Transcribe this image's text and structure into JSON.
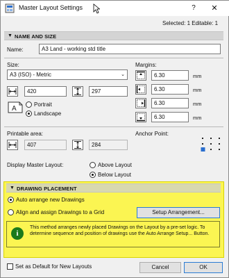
{
  "window": {
    "title": "Master Layout Settings",
    "help_glyph": "?",
    "close_glyph": "✕"
  },
  "selected_info": "Selected: 1 Editable: 1",
  "name_size": {
    "header": "NAME AND SIZE",
    "name_label": "Name:",
    "name_value": "A3 Land - working std title",
    "size_label": "Size:",
    "size_value": "A3 (ISO) - Metric",
    "width_value": "420",
    "height_value": "297",
    "portrait_label": "Portrait",
    "landscape_label": "Landscape",
    "orientation_selected": "Landscape",
    "margins_label": "Margins:",
    "margins": [
      {
        "value": "6.30",
        "unit": "mm"
      },
      {
        "value": "6.30",
        "unit": "mm"
      },
      {
        "value": "6.30",
        "unit": "mm"
      },
      {
        "value": "6.30",
        "unit": "mm"
      }
    ],
    "printable_label": "Printable area:",
    "printable_width": "407",
    "printable_height": "284",
    "anchor_label": "Anchor Point:",
    "display_label": "Display Master Layout:",
    "above_label": "Above Layout",
    "below_label": "Below Layout",
    "display_selected": "Below Layout"
  },
  "drawing_placement": {
    "header": "DRAWING PLACEMENT",
    "auto_label": "Auto arrange new Drawings",
    "align_label": "Align and assign Drawings to a Grid",
    "selected": "Auto arrange new Drawings",
    "setup_button": "Setup Arrangement...",
    "info_text": "This method arranges newly placed Drawings on the Layout by a pre-set logic. To determine sequence and position of drawings use the Auto Arrange Setup... Button."
  },
  "footer": {
    "default_checkbox_label": "Set as Default for New Layouts",
    "cancel_label": "Cancel",
    "ok_label": "OK"
  },
  "colors": {
    "highlight": "#fbf552",
    "info_icon": "#1b7a1b",
    "default_button_border": "#2a7bd4"
  }
}
